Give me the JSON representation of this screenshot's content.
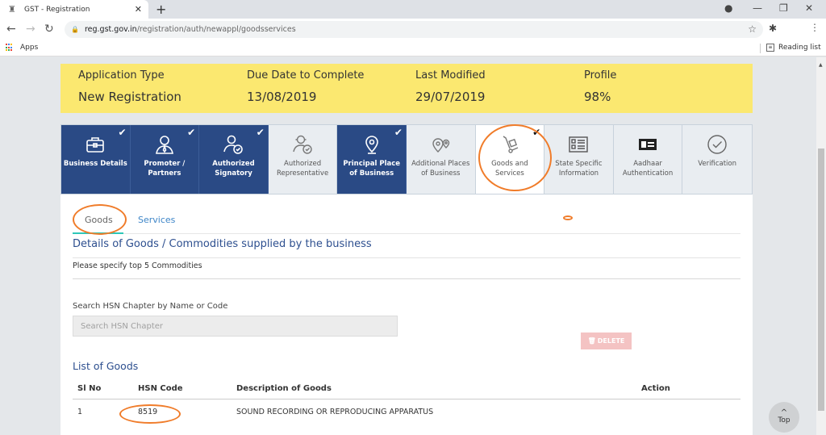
{
  "browser": {
    "tab_title": "GST - Registration",
    "url_host": "reg.gst.gov.in",
    "url_path": "/registration/auth/newappl/goodsservices",
    "bookmarks": {
      "apps_label": "Apps",
      "reading_list_label": "Reading list"
    }
  },
  "summary": [
    {
      "label": "Application Type",
      "value": "New Registration"
    },
    {
      "label": "Due Date to Complete",
      "value": "13/08/2019"
    },
    {
      "label": "Last Modified",
      "value": "29/07/2019"
    },
    {
      "label": "Profile",
      "value": "98%"
    }
  ],
  "steps": [
    {
      "label": "Business Details",
      "status": "done",
      "icon": "briefcase-icon"
    },
    {
      "label": "Promoter / Partners",
      "status": "done",
      "icon": "person-tie-icon"
    },
    {
      "label": "Authorized Signatory",
      "status": "done",
      "icon": "signatory-icon"
    },
    {
      "label": "Authorized Representative",
      "status": "pending",
      "icon": "representative-icon"
    },
    {
      "label": "Principal Place of Business",
      "status": "done",
      "icon": "location-pin-icon"
    },
    {
      "label": "Additional Places of Business",
      "status": "pending",
      "icon": "multi-location-icon"
    },
    {
      "label": "Goods and Services",
      "status": "active",
      "icon": "hand-truck-icon"
    },
    {
      "label": "State Specific Information",
      "status": "pending",
      "icon": "form-list-icon"
    },
    {
      "label": "Aadhaar Authentication",
      "status": "pending",
      "icon": "id-card-icon"
    },
    {
      "label": "Verification",
      "status": "pending",
      "icon": "check-circle-icon"
    }
  ],
  "subtabs": {
    "goods": "Goods",
    "services": "Services"
  },
  "section": {
    "title": "Details of Goods / Commodities supplied by the business",
    "hint": "Please specify top 5 Commodities",
    "search_label": "Search HSN Chapter by Name or Code",
    "search_placeholder": "Search HSN Chapter",
    "search_value": ""
  },
  "goods_list": {
    "title": "List of Goods",
    "columns": [
      "Sl No",
      "HSN Code",
      "Description of Goods",
      "Action"
    ],
    "rows": [
      {
        "sl_no": "1",
        "hsn_code": "8519",
        "description": "SOUND RECORDING OR REPRODUCING APPARATUS",
        "action": "DELETE"
      }
    ]
  },
  "top_button": "Top",
  "colors": {
    "summary_bg": "#fbe870",
    "step_done": "#2a4a85",
    "heading_blue": "#2d4f8f",
    "annotation": "#f07c2a",
    "tab_ink": "#2ec7b8"
  }
}
